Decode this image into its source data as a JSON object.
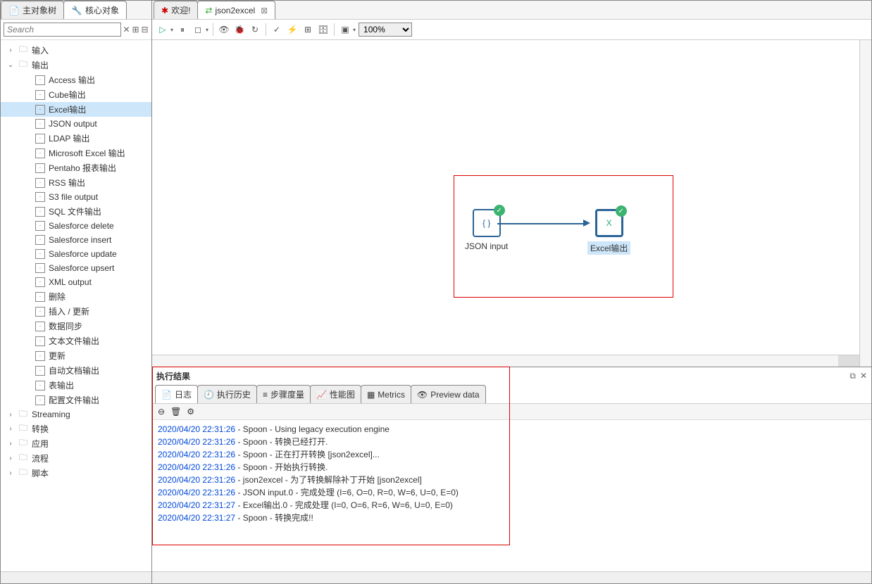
{
  "sidebar": {
    "tabs": [
      {
        "label": "主对象树"
      },
      {
        "label": "核心对象"
      }
    ],
    "search_placeholder": "Search",
    "tree": {
      "input_group": "输入",
      "output_group": "输出",
      "output_items": [
        "Access 输出",
        "Cube输出",
        "Excel输出",
        "JSON output",
        "LDAP 输出",
        "Microsoft Excel 输出",
        "Pentaho 报表输出",
        "RSS 输出",
        "S3 file output",
        "SQL 文件输出",
        "Salesforce delete",
        "Salesforce insert",
        "Salesforce update",
        "Salesforce upsert",
        "XML output",
        "删除",
        "插入 / 更新",
        "数据同步",
        "文本文件输出",
        "更新",
        "自动文档输出",
        "表输出",
        "配置文件输出"
      ],
      "groups_tail": [
        "Streaming",
        "转换",
        "应用",
        "流程",
        "脚本"
      ]
    }
  },
  "main": {
    "tabs": [
      {
        "label": "欢迎!"
      },
      {
        "label": "json2excel"
      }
    ],
    "zoom": "100%",
    "node1": "JSON input",
    "node2": "Excel输出"
  },
  "results": {
    "title": "执行结果",
    "tabs": [
      "日志",
      "执行历史",
      "步骤度量",
      "性能图",
      "Metrics",
      "Preview data"
    ],
    "log": [
      {
        "ts": "2020/04/20 22:31:26",
        "msg": " - Spoon - Using legacy execution engine"
      },
      {
        "ts": "2020/04/20 22:31:26",
        "msg": " - Spoon - 转换已经打开."
      },
      {
        "ts": "2020/04/20 22:31:26",
        "msg": " - Spoon - 正在打开转换 [json2excel]..."
      },
      {
        "ts": "2020/04/20 22:31:26",
        "msg": " - Spoon - 开始执行转换."
      },
      {
        "ts": "2020/04/20 22:31:26",
        "msg": " - json2excel - 为了转换解除补丁开始  [json2excel]"
      },
      {
        "ts": "2020/04/20 22:31:26",
        "msg": " - JSON input.0 - 完成处理 (I=6, O=0, R=0, W=6, U=0, E=0)"
      },
      {
        "ts": "2020/04/20 22:31:27",
        "msg": " - Excel输出.0 - 完成处理 (I=0, O=6, R=6, W=6, U=0, E=0)"
      },
      {
        "ts": "2020/04/20 22:31:27",
        "msg": " - Spoon - 转换完成!!"
      }
    ]
  }
}
